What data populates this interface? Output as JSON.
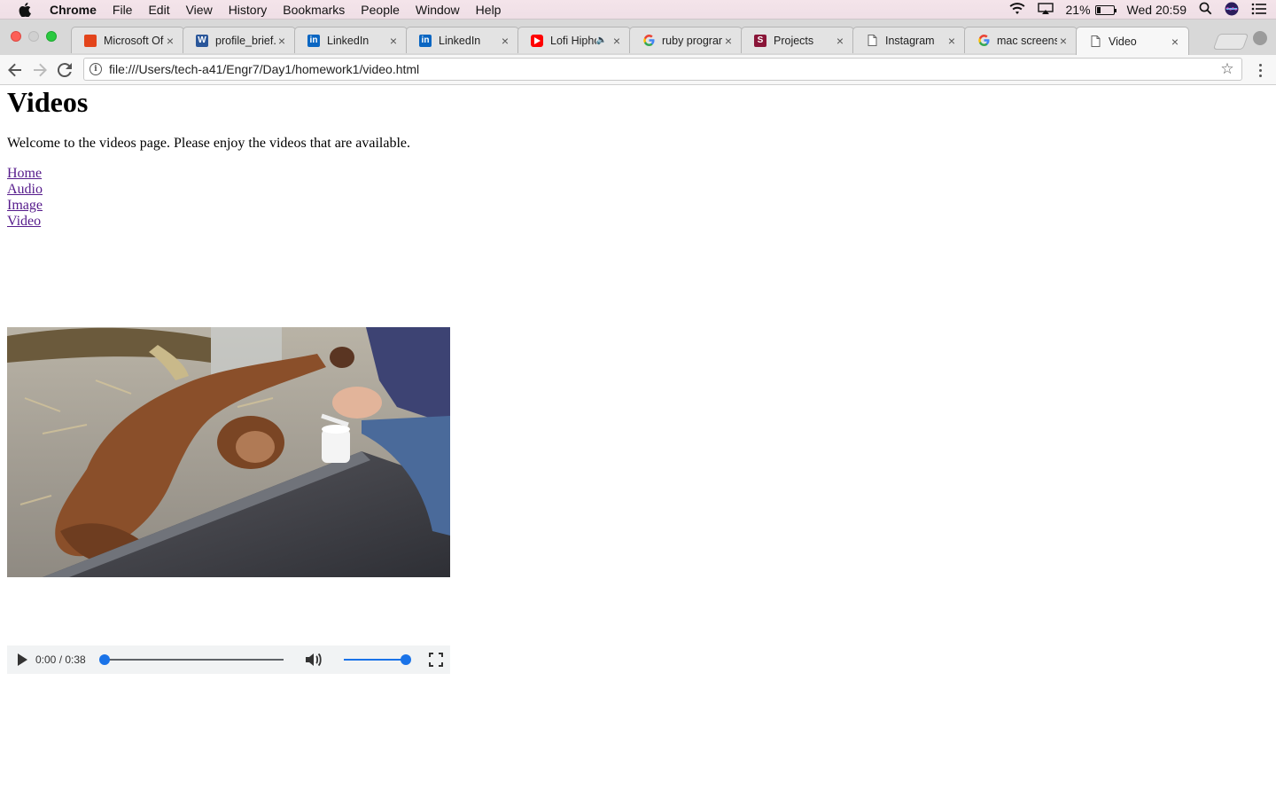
{
  "menubar": {
    "app": "Chrome",
    "items": [
      "File",
      "Edit",
      "View",
      "History",
      "Bookmarks",
      "People",
      "Window",
      "Help"
    ],
    "battery": "21%",
    "battery_level": 0.21,
    "clock": "Wed 20:59"
  },
  "tabs": [
    {
      "title": "Microsoft Of",
      "icon": "office-icon",
      "color": "#e3441b"
    },
    {
      "title": "profile_brief.c",
      "icon": "word-icon",
      "color": "#2b579a"
    },
    {
      "title": "LinkedIn",
      "icon": "linkedin-icon",
      "color": "#0a66c2"
    },
    {
      "title": "LinkedIn",
      "icon": "linkedin-icon",
      "color": "#0a66c2"
    },
    {
      "title": "Lofi Hipho",
      "icon": "youtube-icon",
      "color": "#ff0000"
    },
    {
      "title": "ruby program",
      "icon": "google-icon",
      "color": "#4285f4"
    },
    {
      "title": "Projects",
      "icon": "projects-icon",
      "color": "#8a1538"
    },
    {
      "title": "Instagram",
      "icon": "page-icon",
      "color": "#888888"
    },
    {
      "title": "mac screensh",
      "icon": "google-icon",
      "color": "#4285f4"
    },
    {
      "title": "Video",
      "icon": "page-icon",
      "color": "#888888"
    }
  ],
  "active_tab_index": 9,
  "toolbar": {
    "url": "file:///Users/tech-a41/Engr7/Day1/homework1/video.html"
  },
  "page": {
    "heading": "Videos",
    "intro": "Welcome to the videos page. Please enjoy the videos that are available.",
    "links": [
      "Home",
      "Audio",
      "Image",
      "Video"
    ]
  },
  "video": {
    "time": "0:00 / 0:38",
    "progress": 0,
    "volume": 1
  }
}
